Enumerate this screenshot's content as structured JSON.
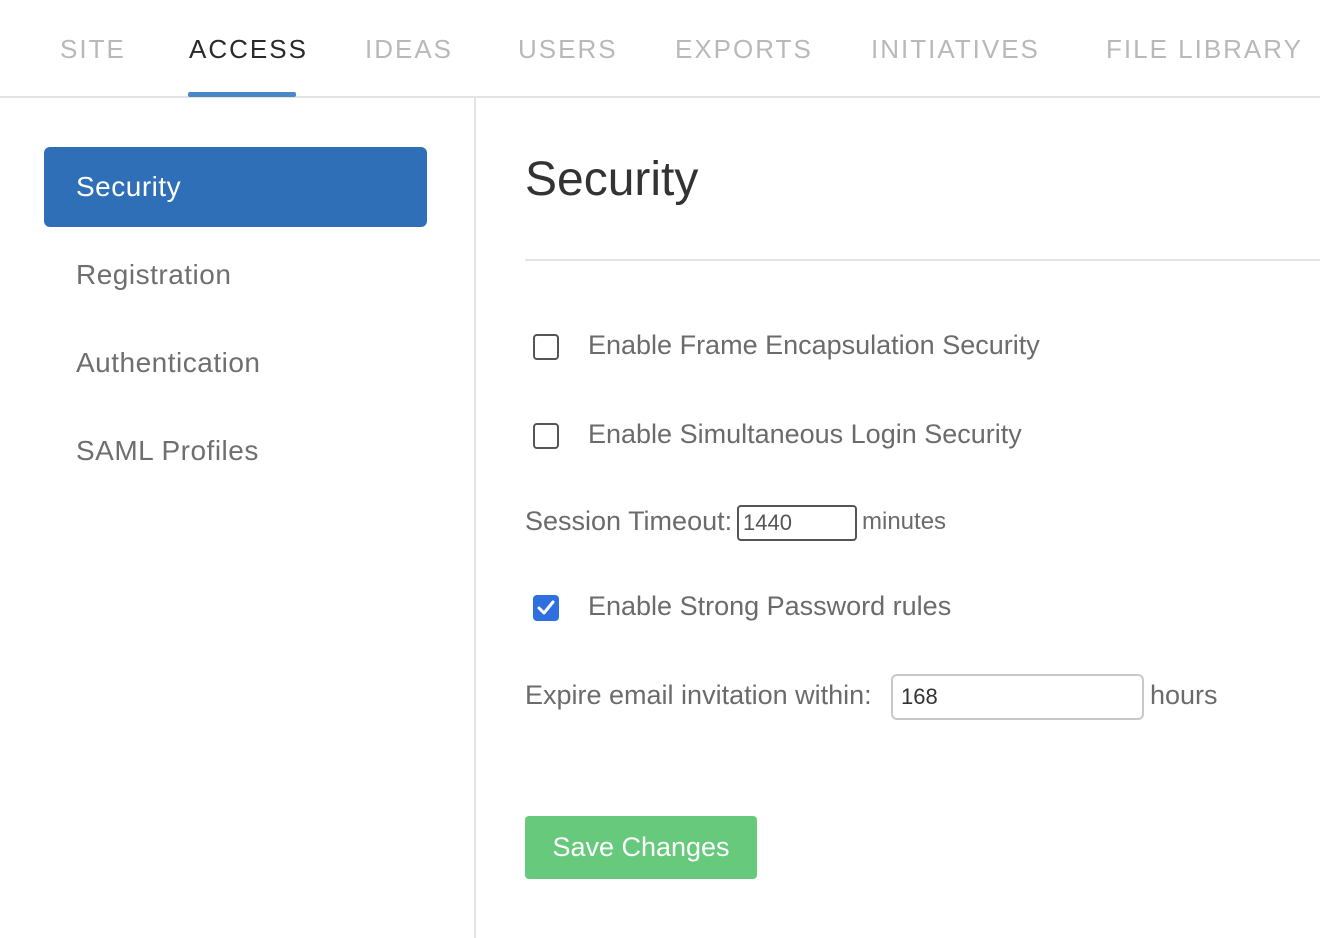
{
  "tabs": [
    {
      "label": "SITE"
    },
    {
      "label": "ACCESS"
    },
    {
      "label": "IDEAS"
    },
    {
      "label": "USERS"
    },
    {
      "label": "EXPORTS"
    },
    {
      "label": "INITIATIVES"
    },
    {
      "label": "FILE LIBRARY"
    }
  ],
  "sidebar": {
    "items": [
      {
        "label": "Security"
      },
      {
        "label": "Registration"
      },
      {
        "label": "Authentication"
      },
      {
        "label": "SAML Profiles"
      }
    ]
  },
  "main": {
    "title": "Security",
    "frame_encapsulation": {
      "label": "Enable Frame Encapsulation Security",
      "checked": false
    },
    "simultaneous_login": {
      "label": "Enable Simultaneous Login Security",
      "checked": false
    },
    "session_timeout": {
      "label": "Session Timeout:",
      "value": "1440",
      "unit": "minutes"
    },
    "strong_password": {
      "label": "Enable Strong Password rules",
      "checked": true
    },
    "expire_invitation": {
      "label": "Expire email invitation within:",
      "value": "168",
      "unit": "hours"
    },
    "save_label": "Save Changes"
  },
  "colors": {
    "accent": "#2f6fb8",
    "save_button": "#66c97b",
    "checkbox_checked": "#2f6fe0"
  }
}
